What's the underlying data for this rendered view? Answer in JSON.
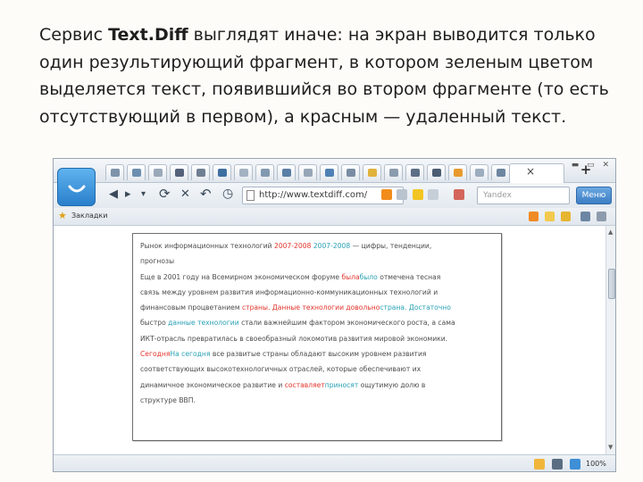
{
  "slide": {
    "text_before": "Сервис ",
    "text_bold": "Text.Diff",
    "text_after": " выглядят иначе: на экран выводится только один результирующий фрагмент, в котором зеленым цветом выделяется текст, появившийся во втором фрагменте (то есть отсутствующий в первом), а красным — удаленный текст."
  },
  "browser": {
    "url": "http://www.textdiff.com/",
    "search_placeholder": "Yandex",
    "menu_label": "Меню",
    "bookmarks_label": "Закладки",
    "zoom": "100%",
    "tab_close": "×",
    "tab_new": "+",
    "window_controls": "▬ ▭ ✕",
    "nav": {
      "back": "◀",
      "forward": "▸",
      "dropdown": "▾",
      "reload": "⟳",
      "stop": "✕",
      "undo": "↶",
      "history": "◷"
    },
    "scroll_up": "▲",
    "scroll_down": "▼",
    "colors": {
      "deleted": "#e2352d",
      "inserted": "#2aa1b4",
      "menu_button": "#3c7ec4"
    }
  },
  "diff_lines": [
    [
      {
        "t": "Рынок информационных технологий ",
        "s": "n"
      },
      {
        "t": "2007-2008",
        "s": "d"
      },
      {
        "t": " ",
        "s": "n"
      },
      {
        "t": "2007-2008",
        "s": "i"
      },
      {
        "t": " — цифры, тенденции,",
        "s": "n"
      }
    ],
    [
      {
        "t": "прогнозы",
        "s": "n"
      }
    ],
    [
      {
        "t": "Еще в 2001 году на Всемирном экономическом форуме ",
        "s": "n"
      },
      {
        "t": "была",
        "s": "d"
      },
      {
        "t": "было",
        "s": "i"
      },
      {
        "t": " отмечена тесная",
        "s": "n"
      }
    ],
    [
      {
        "t": "связь между уровнем развития информационно-коммуникационных технологий и",
        "s": "n"
      }
    ],
    [
      {
        "t": "финансовым процветанием ",
        "s": "n"
      },
      {
        "t": "страны. Данные технологии довольно",
        "s": "d"
      },
      {
        "t": "страна. Достаточно",
        "s": "i"
      }
    ],
    [
      {
        "t": "быстро ",
        "s": "n"
      },
      {
        "t": "данные технологии",
        "s": "i"
      },
      {
        "t": " стали важнейшим фактором экономического роста, а сама",
        "s": "n"
      }
    ],
    [
      {
        "t": "ИКТ-отрасль превратилась в своеобразный локомотив развития мировой экономики.",
        "s": "n"
      }
    ],
    [
      {
        "t": "Сегодня",
        "s": "d"
      },
      {
        "t": "На сегодня",
        "s": "i"
      },
      {
        "t": " все развитые страны обладают высоким уровнем развития",
        "s": "n"
      }
    ],
    [
      {
        "t": "соответствующих высокотехнологичных отраслей, которые обеспечивают их",
        "s": "n"
      }
    ],
    [
      {
        "t": "динамичное экономическое развитие и ",
        "s": "n"
      },
      {
        "t": "составляет",
        "s": "d"
      },
      {
        "t": "приносят",
        "s": "i"
      },
      {
        "t": " ощутимую долю в",
        "s": "n"
      }
    ],
    [
      {
        "t": "структуре ВВП.",
        "s": "n"
      }
    ]
  ]
}
